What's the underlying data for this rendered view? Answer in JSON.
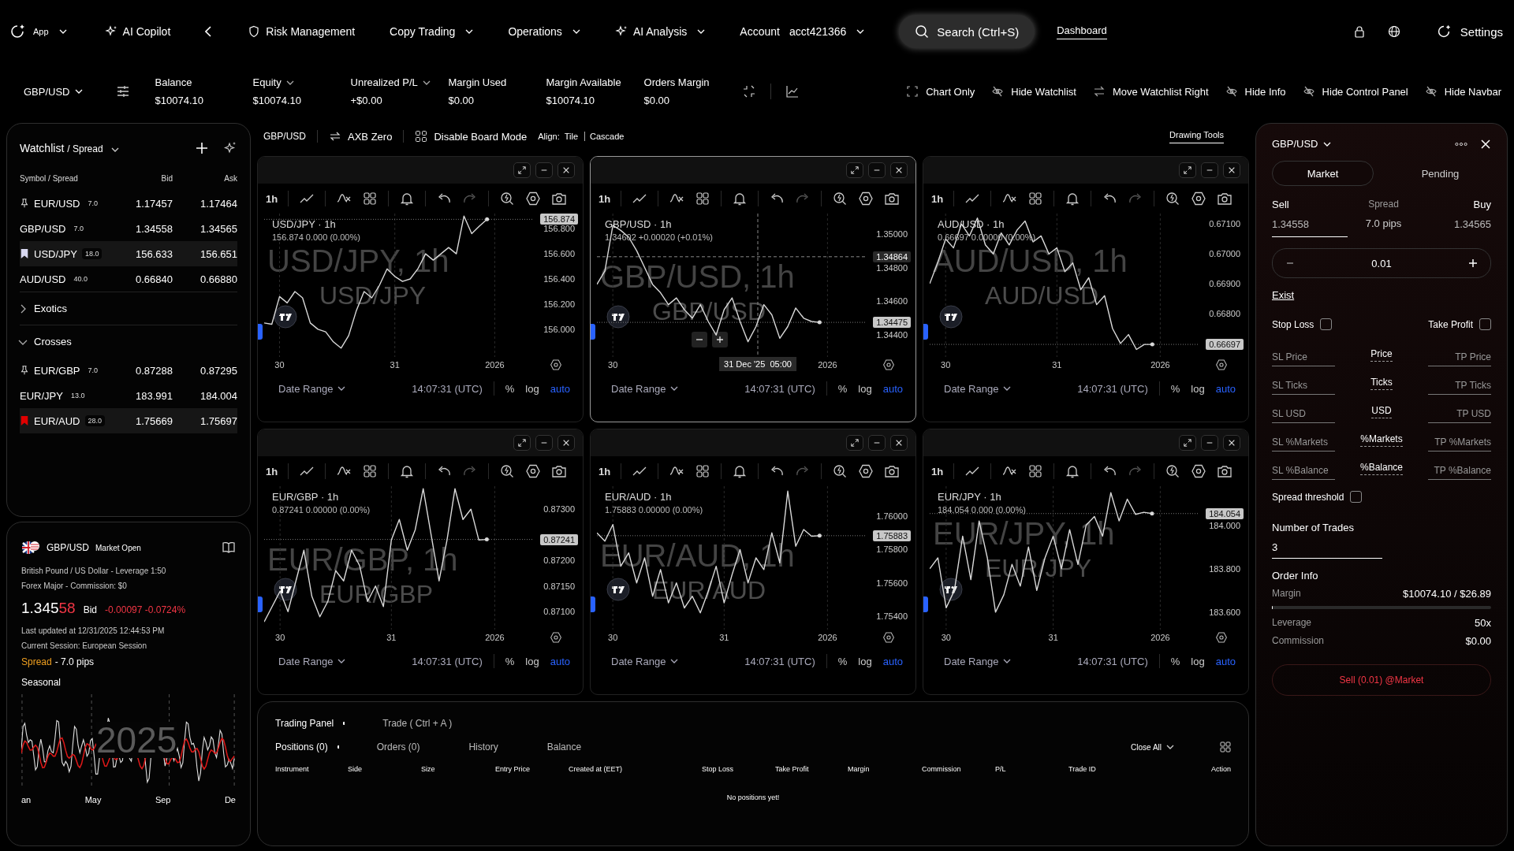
{
  "nav": {
    "app": "App",
    "items": [
      {
        "label": "AI Copilot",
        "caret": false
      },
      {
        "label": "Risk Management",
        "caret": false
      },
      {
        "label": "Copy Trading",
        "caret": true
      },
      {
        "label": "Operations",
        "caret": true
      },
      {
        "label": "AI Analysis",
        "caret": true
      }
    ],
    "account_label": "Account",
    "account_id": "acct421366",
    "search": "Search (Ctrl+S)",
    "dashboard": "Dashboard",
    "settings": "Settings"
  },
  "stats_bar": {
    "symbol": "GBP/USD",
    "stats": [
      {
        "label": "Balance",
        "value": "$10074.10",
        "caret": false
      },
      {
        "label": "Equity",
        "value": "$10074.10",
        "caret": true
      },
      {
        "label": "Unrealized P/L",
        "value": "+$0.00",
        "caret": true
      },
      {
        "label": "Margin Used",
        "value": "$0.00",
        "caret": false
      },
      {
        "label": "Margin Available",
        "value": "$10074.10",
        "caret": false
      },
      {
        "label": "Orders Margin",
        "value": "$0.00",
        "caret": false
      }
    ],
    "view_toggles": [
      "Chart Only",
      "Hide Watchlist",
      "Move Watchlist Right",
      "Hide Info",
      "Hide Control Panel",
      "Hide Navbar"
    ]
  },
  "watchlist": {
    "title": "Watchlist",
    "subtitle": "/ Spread",
    "columns": [
      "Symbol / Spread",
      "Bid",
      "Ask"
    ],
    "rows": [
      {
        "kind": "pinned",
        "symbol": "EUR/USD",
        "spread": "7.0",
        "bid": "1.17457",
        "ask": "1.17464",
        "selected": false
      },
      {
        "kind": "plain",
        "symbol": "GBP/USD",
        "spread": "7.0",
        "bid": "1.34558",
        "ask": "1.34565",
        "selected": false
      },
      {
        "kind": "bookmarked",
        "color": "#d8d8f0",
        "symbol": "USD/JPY",
        "spread": "18.0",
        "bid": "156.633",
        "ask": "156.651",
        "selected": true
      },
      {
        "kind": "plain",
        "symbol": "AUD/USD",
        "spread": "40.0",
        "bid": "0.66840",
        "ask": "0.66880",
        "selected": false
      }
    ],
    "groups": [
      {
        "label": "Exotics",
        "expanded": false
      },
      {
        "label": "Crosses",
        "expanded": true,
        "rows": [
          {
            "kind": "pinned",
            "symbol": "EUR/GBP",
            "spread": "7.0",
            "bid": "0.87288",
            "ask": "0.87295",
            "selected": false
          },
          {
            "kind": "plain",
            "symbol": "EUR/JPY",
            "spread": "13.0",
            "bid": "183.991",
            "ask": "184.004",
            "selected": false
          },
          {
            "kind": "bookmarked",
            "color": "#e00000",
            "symbol": "EUR/AUD",
            "spread": "28.0",
            "bid": "1.75669",
            "ask": "1.75697",
            "selected": true
          }
        ]
      }
    ]
  },
  "info": {
    "symbol": "GBP/USD",
    "status": "Market Open",
    "description": "British Pound / US Dollar - Leverage 1:50",
    "category": "Forex Major - Commission: $0",
    "price_main": "1.345",
    "price_pips": "58",
    "price_side": "Bid",
    "change": "-0.00097 -0.0724%",
    "updated": "Last updated at 12/31/2025 12:44:53 PM",
    "session": "Current Session: European Session",
    "spread_label": "Spread",
    "spread_value": "- 7.0 pips",
    "seasonal_title": "Seasonal",
    "seasonal_year": "2025",
    "seasonal_months": [
      "an",
      "May",
      "Sep",
      "De"
    ]
  },
  "board": {
    "symbol": "GBP/USD",
    "server": "AXB Zero",
    "board_mode": "Disable Board Mode",
    "align_label": "Align:",
    "align_options": [
      "Tile",
      "Cascade"
    ],
    "drawing_tools": "Drawing Tools"
  },
  "charts": [
    {
      "selected": false,
      "interval": "1h",
      "title": "USD/JPY · 1h",
      "quote": "156.874 0.000 (0.00%)",
      "watermark_title": "USD/JPY, 1h",
      "watermark_symbol": "USD/JPY",
      "date_range": "Date Range",
      "time": "14:07:31 (UTC)",
      "percent": "%",
      "log": "log",
      "auto": "auto",
      "chart_data": {
        "type": "line",
        "categories": [
          null,
          null,
          "30",
          null,
          null,
          null,
          null,
          null,
          null,
          null,
          null,
          null,
          null,
          null,
          null,
          null,
          null,
          "31",
          null,
          null,
          null,
          null,
          null,
          null,
          null,
          null,
          null,
          null,
          null,
          null,
          "2026"
        ],
        "ylim": [
          155.78,
          156.92
        ],
        "grid": true,
        "ref_lines": [
          {
            "axis": "y",
            "value": 156.874,
            "label": "156.874"
          }
        ],
        "yticks": [
          {
            "value": 156.8,
            "label": "156.800"
          },
          {
            "value": 156.6,
            "label": "156.600"
          },
          {
            "value": 156.4,
            "label": "156.400"
          },
          {
            "value": 156.2,
            "label": "156.200"
          },
          {
            "value": 156.0,
            "label": "156.000"
          }
        ],
        "series": [
          {
            "color": "#d9d9d9",
            "values": [
              156.05,
              156.04,
              156.26,
              156.21,
              156.3,
              156.25,
              156.05,
              156.0,
              155.98,
              155.9,
              155.85,
              155.95,
              156.15,
              156.3,
              156.25,
              156.35,
              156.48,
              156.42,
              156.38,
              156.4,
              156.48,
              156.6,
              156.55,
              156.6,
              156.65,
              156.6,
              156.9,
              156.76,
              156.82,
              156.874,
              null
            ]
          }
        ]
      }
    },
    {
      "selected": true,
      "interval": "1h",
      "crosshair_label": "31 Dec '25  05:00",
      "title": "GBP/USD · 1h",
      "quote": "1.34602 +0.00020 (+0.01%)",
      "watermark_title": "GBP/USD, 1h",
      "watermark_symbol": "GBP/USD",
      "date_range": "Date Range",
      "time": "14:07:31 (UTC)",
      "percent": "%",
      "log": "log",
      "auto": "auto",
      "chart_data": {
        "type": "line",
        "categories": [
          null,
          null,
          "30",
          null,
          null,
          null,
          null,
          null,
          null,
          null,
          null,
          null,
          null,
          null,
          null,
          null,
          null,
          null,
          null,
          null,
          null,
          null,
          null,
          null,
          null,
          null,
          null,
          null,
          null,
          "2026"
        ],
        "ylim": [
          1.3427,
          1.3512
        ],
        "grid": true,
        "ref_lines": [
          {
            "axis": "y",
            "value": 1.34864,
            "label": "1.34864"
          },
          {
            "axis": "y",
            "value": 1.34475,
            "label": "1.34475"
          }
        ],
        "yticks": [
          {
            "value": 1.35,
            "label": "1.35000"
          },
          {
            "value": 1.348,
            "label": "1.34800"
          },
          {
            "value": 1.346,
            "label": "1.34600"
          },
          {
            "value": 1.344,
            "label": "1.34400"
          }
        ],
        "series": [
          {
            "color": "#d9d9d9",
            "values": [
              1.347,
              1.3478,
              1.3505,
              1.3502,
              1.3498,
              1.349,
              1.348,
              1.347,
              1.3465,
              1.3458,
              1.3462,
              1.3455,
              1.345,
              1.3458,
              1.3448,
              1.344,
              1.3455,
              1.3462,
              1.3448,
              1.3436,
              1.3445,
              1.3458,
              1.3452,
              1.3438,
              1.3445,
              1.3456,
              1.345,
              1.3448,
              1.34475,
              null
            ]
          }
        ]
      }
    },
    {
      "selected": false,
      "interval": "1h",
      "title": "AUD/USD · 1h",
      "quote": "0.66697 0.00000 (0.00%)",
      "watermark_title": "AUD/USD, 1h",
      "watermark_symbol": "AUD/USD",
      "date_range": "Date Range",
      "time": "14:07:31 (UTC)",
      "percent": "%",
      "log": "log",
      "auto": "auto",
      "chart_data": {
        "type": "line",
        "categories": [
          null,
          null,
          "30",
          null,
          null,
          null,
          null,
          null,
          null,
          null,
          null,
          null,
          null,
          null,
          null,
          null,
          "31",
          null,
          null,
          null,
          null,
          null,
          null,
          null,
          null,
          null,
          null,
          null,
          null,
          "2026"
        ],
        "ylim": [
          0.66655,
          0.67135
        ],
        "grid": true,
        "ref_lines": [
          {
            "axis": "y",
            "value": 0.66697,
            "label": "0.66697"
          }
        ],
        "yticks": [
          {
            "value": 0.671,
            "label": "0.67100"
          },
          {
            "value": 0.67,
            "label": "0.67000"
          },
          {
            "value": 0.669,
            "label": "0.66900"
          },
          {
            "value": 0.668,
            "label": "0.66800"
          }
        ],
        "series": [
          {
            "color": "#d9d9d9",
            "values": [
              0.669,
              0.6697,
              0.6705,
              0.6702,
              0.671,
              0.6706,
              0.6712,
              0.6703,
              0.67,
              0.6707,
              0.6703,
              0.6708,
              0.6711,
              0.6704,
              0.6706,
              0.67,
              0.6702,
              0.6694,
              0.6697,
              0.6688,
              0.6692,
              0.6683,
              0.6686,
              0.6675,
              0.667,
              0.6673,
              0.6668,
              0.66697,
              0.66697,
              null
            ]
          }
        ]
      }
    },
    {
      "selected": false,
      "interval": "1h",
      "title": "EUR/GBP · 1h",
      "quote": "0.87241 0.00000 (0.00%)",
      "watermark_title": "EUR/GBP, 1h",
      "watermark_symbol": "EUR/GBP",
      "date_range": "Date Range",
      "time": "14:07:31 (UTC)",
      "percent": "%",
      "log": "log",
      "auto": "auto",
      "chart_data": {
        "type": "line",
        "categories": [
          null,
          null,
          "30",
          null,
          null,
          null,
          null,
          null,
          null,
          null,
          null,
          null,
          null,
          null,
          null,
          null,
          "31",
          null,
          null,
          null,
          null,
          null,
          null,
          null,
          null,
          null,
          null,
          null,
          null,
          "2026"
        ],
        "ylim": [
          0.87065,
          0.87345
        ],
        "grid": true,
        "ref_lines": [
          {
            "axis": "y",
            "value": 0.87241,
            "label": "0.87241"
          }
        ],
        "yticks": [
          {
            "value": 0.873,
            "label": "0.87300"
          },
          {
            "value": 0.872,
            "label": "0.87200"
          },
          {
            "value": 0.8715,
            "label": "0.87150"
          },
          {
            "value": 0.871,
            "label": "0.87100"
          }
        ],
        "series": [
          {
            "color": "#d9d9d9",
            "values": [
              0.8708,
              0.8711,
              0.8714,
              0.871,
              0.8716,
              0.8722,
              0.8713,
              0.8709,
              0.8712,
              0.8718,
              0.8716,
              0.8722,
              0.8719,
              0.8712,
              0.8715,
              0.8711,
              0.8724,
              0.8728,
              0.8722,
              0.8726,
              0.8734,
              0.8725,
              0.8716,
              0.8724,
              0.8734,
              0.8728,
              0.873,
              0.8724,
              0.87241,
              null
            ]
          }
        ]
      }
    },
    {
      "selected": false,
      "interval": "1h",
      "title": "EUR/AUD · 1h",
      "quote": "1.75883 0.00000 (0.00%)",
      "watermark_title": "EUR/AUD, 1h",
      "watermark_symbol": "EUR/AUD",
      "date_range": "Date Range",
      "time": "14:07:31 (UTC)",
      "percent": "%",
      "log": "log",
      "auto": "auto",
      "chart_data": {
        "type": "line",
        "categories": [
          null,
          null,
          "30",
          null,
          null,
          null,
          null,
          null,
          null,
          null,
          null,
          null,
          null,
          null,
          null,
          null,
          "31",
          null,
          null,
          null,
          null,
          null,
          null,
          null,
          null,
          null,
          null,
          null,
          null,
          "2026"
        ],
        "ylim": [
          1.7532,
          1.7618
        ],
        "grid": true,
        "ref_lines": [
          {
            "axis": "y",
            "value": 1.75883,
            "label": "1.75883"
          }
        ],
        "yticks": [
          {
            "value": 1.76,
            "label": "1.76000"
          },
          {
            "value": 1.758,
            "label": "1.75800"
          },
          {
            "value": 1.756,
            "label": "1.75600"
          },
          {
            "value": 1.754,
            "label": "1.75400"
          }
        ],
        "series": [
          {
            "color": "#d9d9d9",
            "values": [
              1.759,
              1.7585,
              1.7595,
              1.757,
              1.7578,
              1.756,
              1.7575,
              1.7552,
              1.7568,
              1.7548,
              1.756,
              1.7545,
              1.7552,
              1.7542,
              1.7555,
              1.757,
              1.7548,
              1.7565,
              1.758,
              1.756,
              1.7575,
              1.7568,
              1.759,
              1.7572,
              1.7615,
              1.7582,
              1.7592,
              1.7588,
              1.75883,
              null
            ]
          }
        ]
      }
    },
    {
      "selected": false,
      "interval": "1h",
      "title": "EUR/JPY · 1h",
      "quote": "184.054 0.000 (0.00%)",
      "watermark_title": "EUR/JPY, 1h",
      "watermark_symbol": "EUR/JPY",
      "date_range": "Date Range",
      "time": "14:07:31 (UTC)",
      "percent": "%",
      "log": "log",
      "auto": "auto",
      "chart_data": {
        "type": "line",
        "categories": [
          null,
          null,
          "30",
          null,
          null,
          null,
          null,
          null,
          null,
          null,
          null,
          null,
          null,
          null,
          null,
          "31",
          null,
          null,
          null,
          null,
          null,
          null,
          null,
          null,
          null,
          null,
          null,
          null,
          "2026"
        ],
        "ylim": [
          183.52,
          184.18
        ],
        "grid": true,
        "ref_lines": [
          {
            "axis": "y",
            "value": 184.054,
            "label": "184.054"
          }
        ],
        "yticks": [
          {
            "value": 184.0,
            "label": "184.000"
          },
          {
            "value": 183.8,
            "label": "183.800"
          },
          {
            "value": 183.6,
            "label": "183.600"
          }
        ],
        "series": [
          {
            "color": "#d9d9d9",
            "values": [
              183.8,
              183.85,
              183.62,
              183.7,
              183.95,
              183.75,
              184.02,
              183.85,
              183.6,
              183.68,
              183.82,
              183.72,
              183.9,
              183.7,
              183.85,
              183.95,
              183.8,
              183.98,
              183.82,
              184.0,
              184.04,
              183.95,
              184.15,
              184.02,
              184.12,
              184.05,
              184.06,
              184.054,
              null
            ]
          }
        ]
      }
    }
  ],
  "trading_panel": {
    "tabs": [
      {
        "label": "Trading Panel",
        "selected": true
      },
      {
        "label": "Trade ( Ctrl + A )",
        "selected": false
      }
    ],
    "subtabs": [
      {
        "label": "Positions (0)",
        "selected": true
      },
      {
        "label": "Orders (0)",
        "selected": false
      },
      {
        "label": "History",
        "selected": false
      },
      {
        "label": "Balance",
        "selected": false
      }
    ],
    "close_all": "Close All",
    "columns": [
      "Instrument",
      "Side",
      "Size",
      "Entry Price",
      "Created at (EET)",
      "Stop Loss",
      "Take Profit",
      "Margin",
      "Commission",
      "P/L",
      "Trade ID",
      "Action"
    ],
    "empty": "No positions yet!"
  },
  "order_panel": {
    "symbol": "GBP/USD",
    "order_types": [
      {
        "label": "Market",
        "selected": true
      },
      {
        "label": "Pending",
        "selected": false
      }
    ],
    "sell_label": "Sell",
    "sell_price": "1.34558",
    "spread_label": "Spread",
    "spread_value": "7.0 pips",
    "buy_label": "Buy",
    "buy_price": "1.34565",
    "lot": "0.01",
    "exist": "Exist",
    "stop_loss": {
      "label": "Stop Loss",
      "checked": false
    },
    "take_profit": {
      "label": "Take Profit",
      "checked": false
    },
    "sltp_rows": [
      {
        "sl": {
          "placeholder": "SL Price"
        },
        "mode": "Price",
        "tp": {
          "placeholder": "TP Price"
        }
      },
      {
        "sl": {
          "placeholder": "SL Ticks"
        },
        "mode": "Ticks",
        "tp": {
          "placeholder": "TP Ticks"
        }
      },
      {
        "sl": {
          "placeholder": "SL USD"
        },
        "mode": "USD",
        "tp": {
          "placeholder": "TP USD"
        }
      },
      {
        "sl": {
          "placeholder": "SL %Markets"
        },
        "mode": "%Markets",
        "tp": {
          "placeholder": "TP %Markets"
        }
      },
      {
        "sl": {
          "placeholder": "SL %Balance"
        },
        "mode": "%Balance",
        "tp": {
          "placeholder": "TP %Balance"
        }
      }
    ],
    "spread_threshold": {
      "label": "Spread threshold",
      "checked": false
    },
    "trades_label": "Number of Trades",
    "trades_value": "3",
    "order_info": "Order Info",
    "margin_label": "Margin",
    "margin_value": "$10074.10 / $26.89",
    "margin_bar": {
      "level": 0.003
    },
    "leverage_label": "Leverage",
    "leverage_value": "50x",
    "commission_label": "Commission",
    "commission_value": "$0.00",
    "submit": "Sell (0.01) @Market"
  }
}
